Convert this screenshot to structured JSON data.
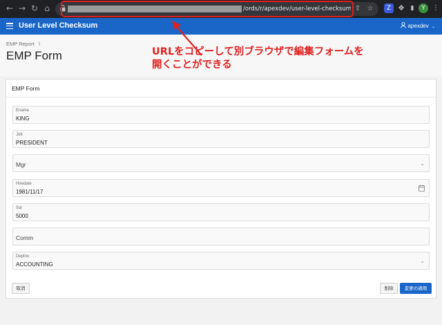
{
  "browser": {
    "url_visible": "/ords/r/apexdev/user-level-checksum/emp-for",
    "profile_initial": "Y",
    "ext_z": "Z"
  },
  "app": {
    "title": "User Level Checksum",
    "user": "apexdev"
  },
  "page": {
    "breadcrumb": "EMP Report",
    "breadcrumb_sep": "\\",
    "title": "EMP Form"
  },
  "annotation": {
    "line1": "URLをコピーして別ブラウザで編集フォームを",
    "line2": "開くことができる",
    "color": "#e02020"
  },
  "form": {
    "region_title": "EMP Form",
    "fields": {
      "ename": {
        "label": "Ename",
        "value": "KING"
      },
      "job": {
        "label": "Job",
        "value": "PRESIDENT"
      },
      "mgr": {
        "label": "Mgr",
        "value": ""
      },
      "hiredate": {
        "label": "Hiredate",
        "value": "1981/11/17"
      },
      "sal": {
        "label": "Sal",
        "value": "5000"
      },
      "comm": {
        "label": "Comm",
        "value": ""
      },
      "deptno": {
        "label": "Deptno",
        "value": "ACCOUNTING"
      }
    },
    "buttons": {
      "cancel": "取消",
      "delete": "削除",
      "apply": "変更の適用"
    }
  },
  "colors": {
    "header": "#1a66c8",
    "chrome": "#202124"
  }
}
